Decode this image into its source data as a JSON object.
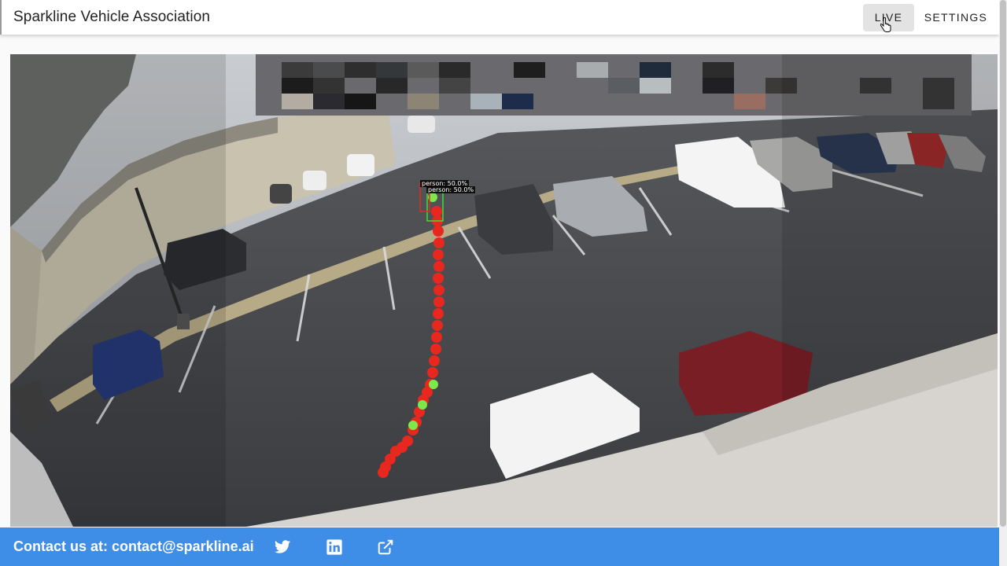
{
  "app": {
    "title": "Sparkline Vehicle Association"
  },
  "nav": {
    "live_label": "LIVE",
    "settings_label": "SETTINGS"
  },
  "feed": {
    "detections": [
      {
        "label": "person: 50.0%"
      },
      {
        "label": "person: 50.0%"
      }
    ],
    "colors": {
      "track_point": "#e8281e",
      "track_highlight": "#7ce84a",
      "box": "#3ddc3d"
    }
  },
  "footer": {
    "contact_text": "Contact us at: contact@sparkline.ai",
    "icons": [
      "twitter-icon",
      "linkedin-icon",
      "external-link-icon"
    ]
  }
}
